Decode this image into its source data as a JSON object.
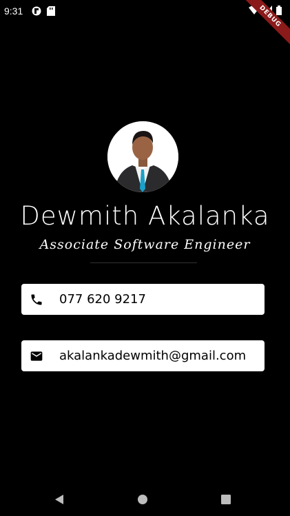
{
  "status_bar": {
    "time": "9:31"
  },
  "debug_banner": {
    "label": "DEBUG"
  },
  "profile": {
    "name": "Dewmith Akalanka",
    "title": "Associate Software Engineer"
  },
  "contacts": [
    {
      "type": "phone",
      "icon": "phone-icon",
      "value": "077 620 9217"
    },
    {
      "type": "email",
      "icon": "mail-icon",
      "value": "akalankadewmith@gmail.com"
    }
  ],
  "colors": {
    "background": "#000000",
    "card": "#ffffff",
    "card_text": "#000000",
    "debug_banner": "#8b1a1a"
  }
}
